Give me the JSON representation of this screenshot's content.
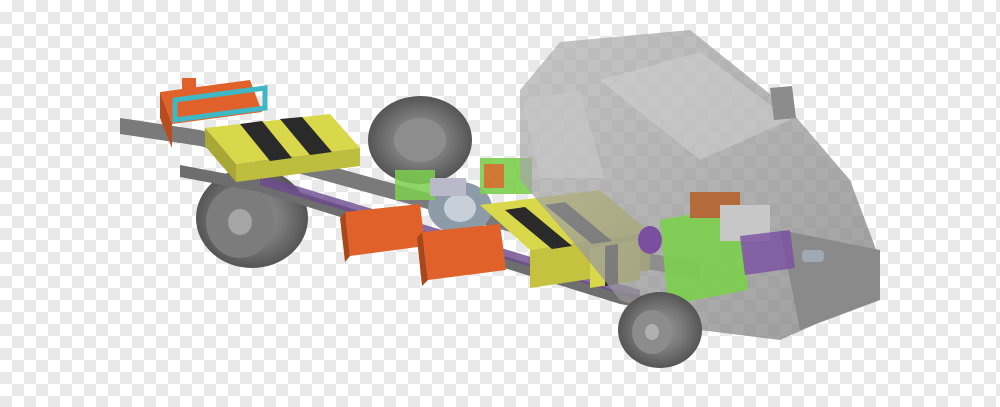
{
  "image": {
    "subject": "",
    "background": "transparency-checkerboard",
    "colors": {
      "cab": "#9a9a9a",
      "tire": "#6d6d6d",
      "frame": "#7a7a7a",
      "battery": "#d9d84a",
      "stripe": "#2a2a2a",
      "orange": "#e0622a",
      "green": "#7ccf4e",
      "purple": "#7a4fa0",
      "teal": "#3fb7c4",
      "brown": "#b46a3a"
    }
  }
}
